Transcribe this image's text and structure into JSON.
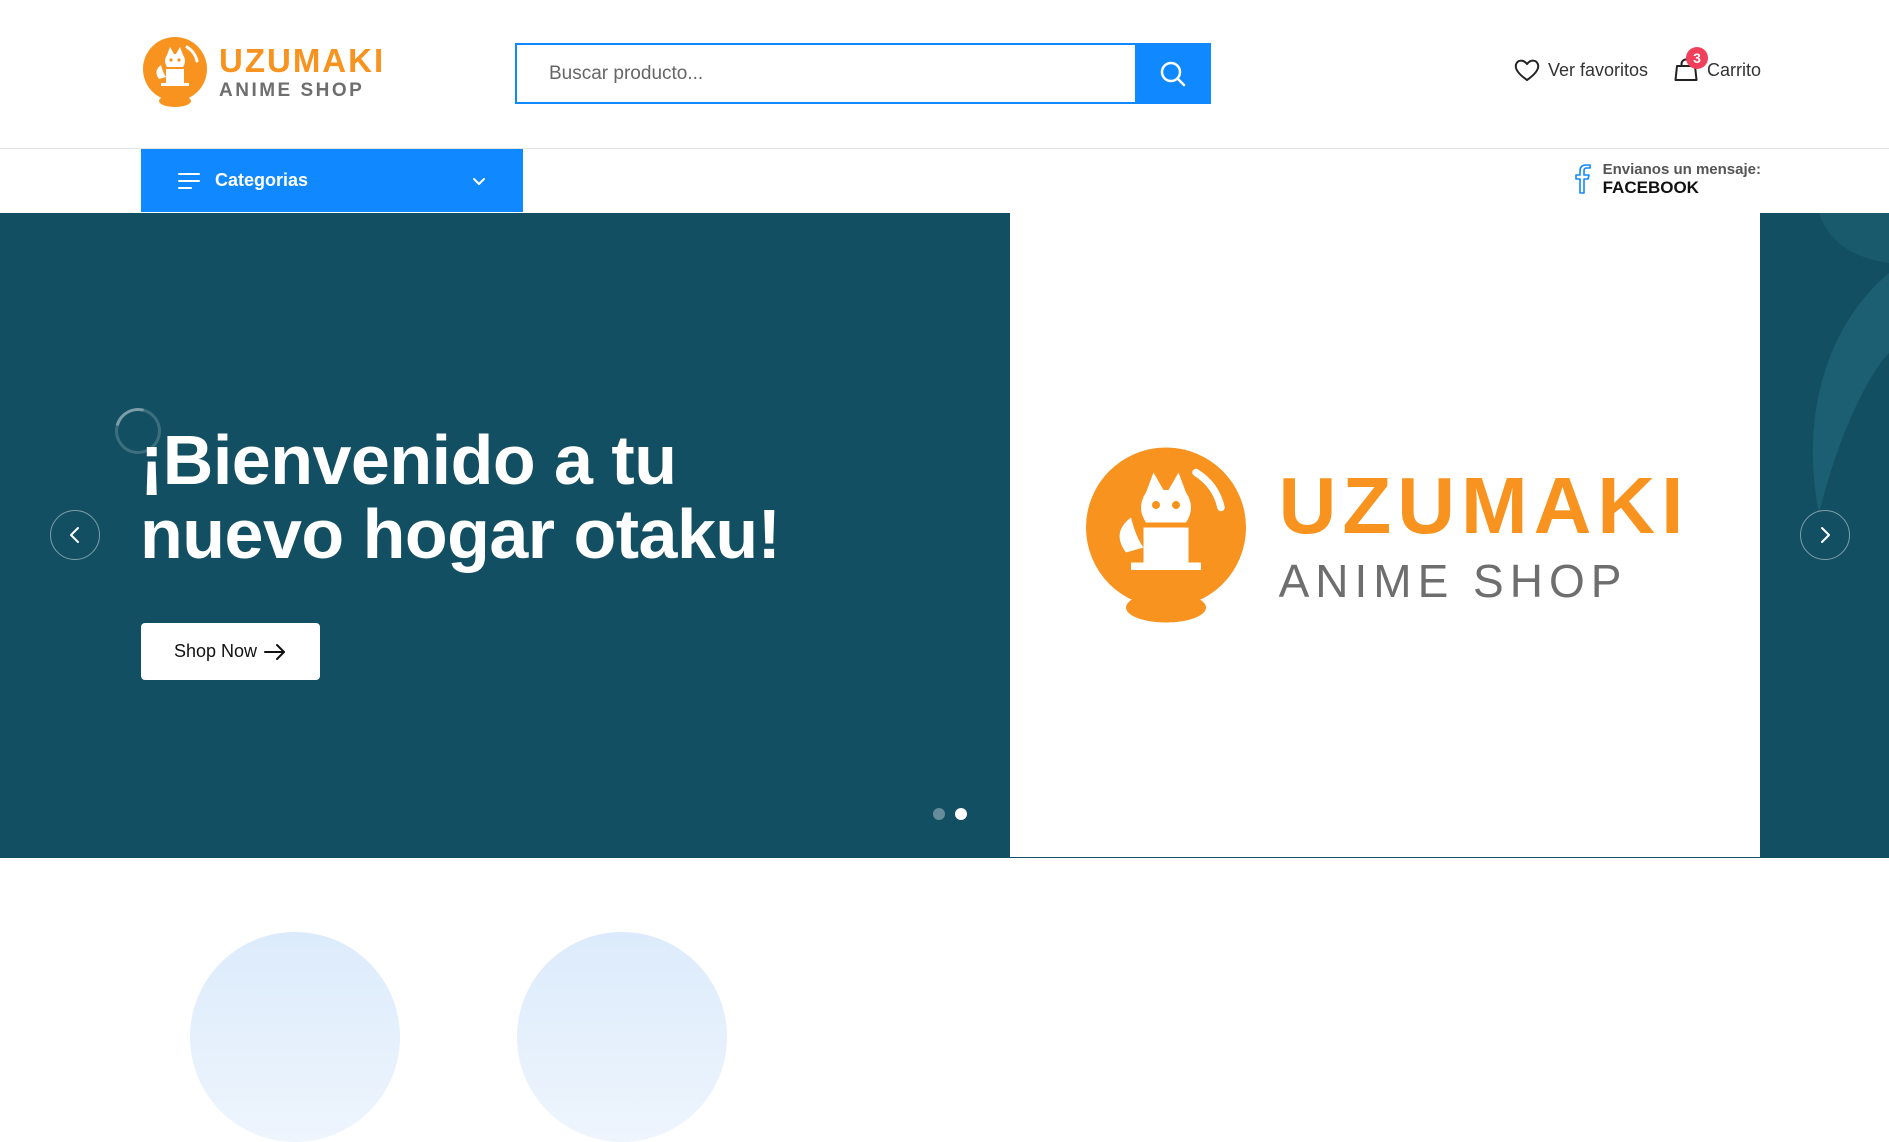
{
  "brand": {
    "name": "UZUMAKI",
    "subtitle": "ANIME SHOP",
    "colors": {
      "orange": "#f7931e",
      "gray": "#6e6e6e",
      "blue": "#1088ff",
      "hero_bg": "#134f62",
      "badge": "#f0405b"
    },
    "icon": "fox-globe-logo"
  },
  "search": {
    "placeholder": "Buscar producto...",
    "value": "",
    "button_icon": "search-icon"
  },
  "header_actions": {
    "favorites_label": "Ver favoritos",
    "favorites_icon": "heart-icon",
    "cart_label": "Carrito",
    "cart_icon": "shopping-bag-icon",
    "cart_count": "3"
  },
  "nav": {
    "categories_label": "Categorias",
    "categories_icon": "menu-lines-icon",
    "categories_chevron": "chevron-down-icon",
    "contact_small": "Envianos un mensaje:",
    "contact_big": "FACEBOOK",
    "contact_icon": "facebook-icon"
  },
  "hero": {
    "title": "¡Bienvenido a tu nuevo hogar otaku!",
    "button_label": "Shop Now",
    "button_icon": "arrow-right-icon",
    "image_logo_name": "UZUMAKI",
    "image_logo_subtitle": "ANIME SHOP",
    "prev_icon": "chevron-left-icon",
    "next_icon": "chevron-right-icon",
    "slides_total": 2,
    "active_slide": 2
  }
}
